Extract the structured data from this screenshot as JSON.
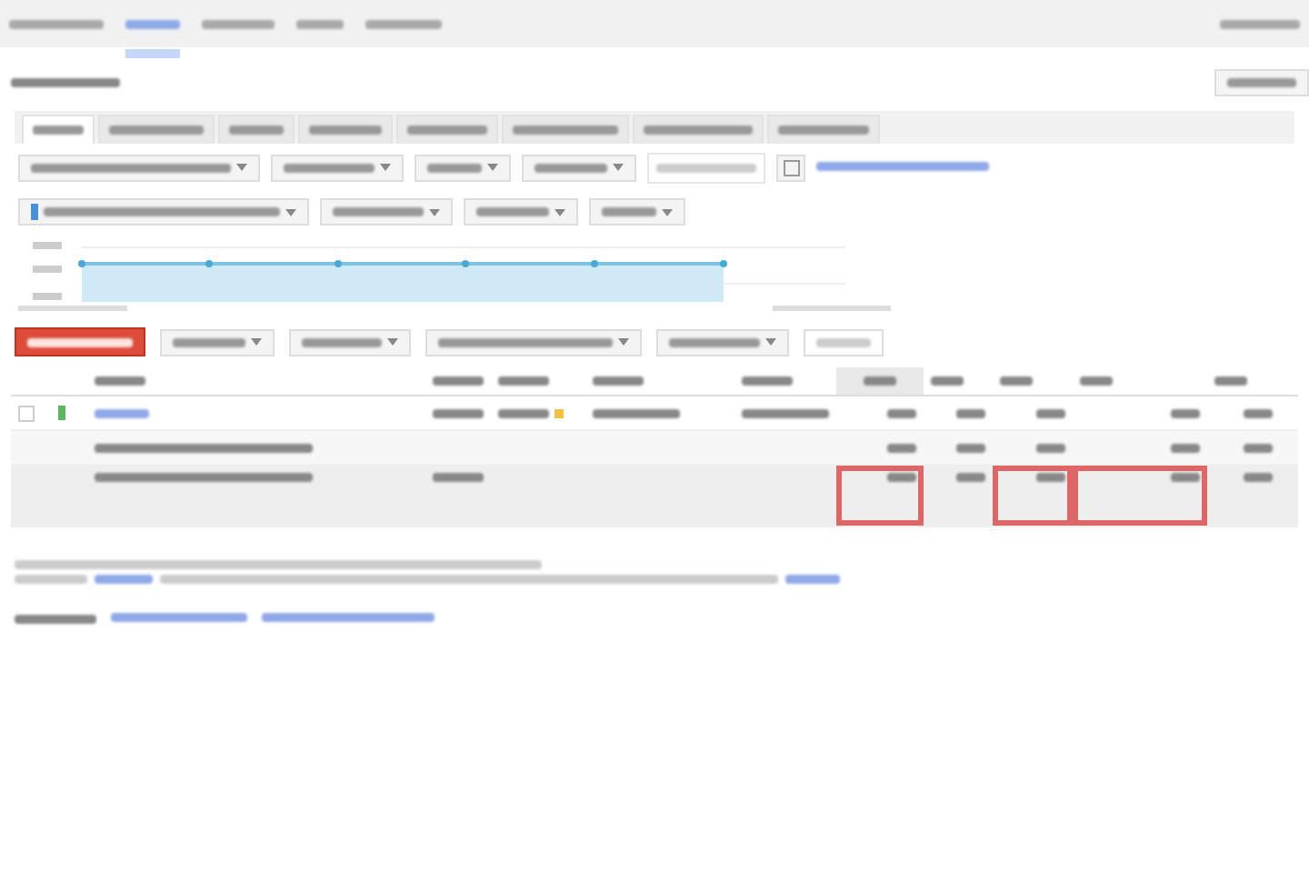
{
  "nav": [
    {
      "selected": false
    },
    {
      "selected": true
    },
    {
      "selected": false
    },
    {
      "selected": false
    },
    {
      "selected": false
    }
  ],
  "tabs": [
    {
      "selected": true
    },
    {
      "selected": false
    },
    {
      "selected": false
    },
    {
      "selected": false
    },
    {
      "selected": false
    },
    {
      "selected": false
    },
    {
      "selected": false
    },
    {
      "selected": false
    }
  ],
  "filters": [
    {
      "kind": "dropdown"
    },
    {
      "kind": "dropdown"
    },
    {
      "kind": "dropdown"
    },
    {
      "kind": "dropdown"
    },
    {
      "kind": "field"
    },
    {
      "kind": "icon"
    },
    {
      "kind": "link"
    }
  ],
  "segments": [
    {
      "kind": "dropdown",
      "checked": true
    },
    {
      "kind": "dropdown",
      "checked": false
    },
    {
      "kind": "dropdown",
      "checked": false
    },
    {
      "kind": "dropdown",
      "checked": false
    }
  ],
  "toolbar": [
    {
      "kind": "primary"
    },
    {
      "kind": "dropdown"
    },
    {
      "kind": "dropdown"
    },
    {
      "kind": "dropdown"
    },
    {
      "kind": "dropdown"
    },
    {
      "kind": "disabled"
    }
  ],
  "table": {
    "columns": [
      {
        "sorted": false
      },
      {
        "sorted": false
      },
      {
        "sorted": false
      },
      {
        "sorted": false
      },
      {
        "sorted": false
      },
      {
        "sorted": false
      },
      {
        "sorted": false
      },
      {
        "sorted": true
      },
      {
        "sorted": false
      },
      {
        "sorted": false
      },
      {
        "sorted": false
      },
      {
        "sorted": false
      }
    ],
    "rows": [
      {
        "kind": "item",
        "cells": [
          {
            "kind": "checkbox",
            "checked": false
          },
          {
            "kind": "status"
          },
          {
            "kind": "link"
          },
          {
            "kind": "text"
          },
          {
            "kind": "warning"
          },
          {
            "kind": "text"
          },
          {
            "kind": "text"
          },
          {
            "kind": "number",
            "highlighted": false
          },
          {
            "kind": "number",
            "highlighted": false
          },
          {
            "kind": "number",
            "highlighted": false
          },
          {
            "kind": "number",
            "highlighted": false
          },
          {
            "kind": "number",
            "highlighted": false
          }
        ]
      },
      {
        "kind": "subtotal",
        "cells": [
          {
            "kind": "empty"
          },
          {
            "kind": "empty"
          },
          {
            "kind": "text"
          },
          {
            "kind": "empty"
          },
          {
            "kind": "empty"
          },
          {
            "kind": "empty"
          },
          {
            "kind": "empty"
          },
          {
            "kind": "number",
            "highlighted": false
          },
          {
            "kind": "number",
            "highlighted": false
          },
          {
            "kind": "number",
            "highlighted": false
          },
          {
            "kind": "number",
            "highlighted": false
          },
          {
            "kind": "number",
            "highlighted": false
          }
        ]
      },
      {
        "kind": "total",
        "cells": [
          {
            "kind": "empty"
          },
          {
            "kind": "empty"
          },
          {
            "kind": "text"
          },
          {
            "kind": "text"
          },
          {
            "kind": "empty"
          },
          {
            "kind": "empty"
          },
          {
            "kind": "empty"
          },
          {
            "kind": "number",
            "highlighted": true
          },
          {
            "kind": "number",
            "highlighted": false
          },
          {
            "kind": "number",
            "highlighted": true
          },
          {
            "kind": "number",
            "highlighted": true
          },
          {
            "kind": "number",
            "highlighted": false
          }
        ]
      }
    ]
  },
  "footer_links": [
    {
      "kind": "label"
    },
    {
      "kind": "link"
    },
    {
      "kind": "link"
    }
  ]
}
